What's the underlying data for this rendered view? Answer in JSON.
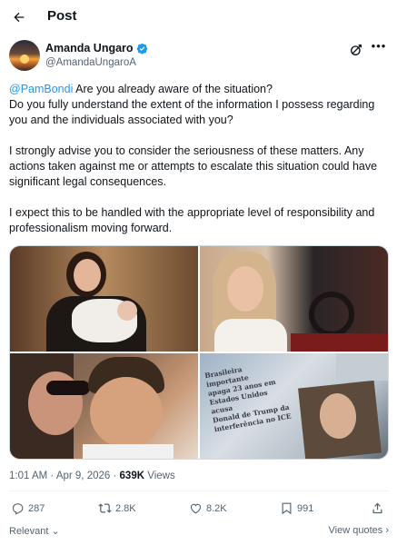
{
  "header": {
    "title": "Post"
  },
  "author": {
    "name": "Amanda Ungaro",
    "handle": "@AmandaUngaroA"
  },
  "tweet": {
    "mention": "@PamBondi",
    "line1_rest": " Are you already aware of the situation?",
    "line2": "Do you fully understand the extent of the information I possess regarding you and the individuals associated with you?",
    "para2": "I strongly advise you to consider the seriousness of these matters. Any actions taken against me or attempts to escalate this situation could have significant legal consequences.",
    "para3": "I expect this to be handled with the appropriate level of responsibility and professionalism moving forward."
  },
  "media": {
    "photo4_text": [
      "Brasileira importante",
      "apaga 23 anos em",
      "Estados Unidos acusa",
      "Donald de Trump da",
      "interferência no ICE"
    ]
  },
  "meta": {
    "time": "1:01 AM",
    "date": "Apr 9, 2026",
    "separator": "·",
    "views_count": "639K",
    "views_label": "Views"
  },
  "actions": {
    "replies": "287",
    "reposts": "2.8K",
    "likes": "8.2K",
    "bookmarks": "991"
  },
  "footer": {
    "sort_label": "Relevant",
    "view_quotes": "View quotes"
  },
  "colors": {
    "accent": "#1d9bf0",
    "text": "#0f1419",
    "muted": "#536471"
  }
}
